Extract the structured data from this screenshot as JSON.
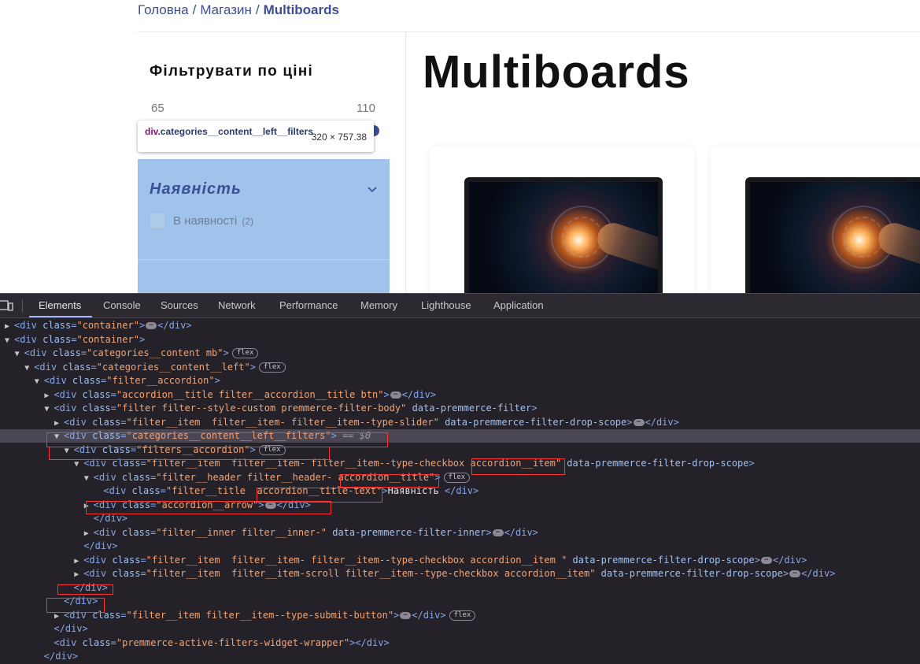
{
  "breadcrumb": {
    "home": "Головна",
    "shop": "Магазин",
    "current": "Multiboards",
    "separator": "/"
  },
  "filter": {
    "title": "Фільтрувати по ціні",
    "price_min": "65",
    "price_max": "110",
    "availability_title": "Наявність",
    "in_stock_label": "В наявності",
    "in_stock_count": "(2)"
  },
  "inspector_tooltip": {
    "tag": "div",
    "class": ".categories__content__left__filters",
    "size": "320 × 757.38"
  },
  "page_heading": "Multiboards",
  "devtools": {
    "tabs": [
      "Elements",
      "Console",
      "Sources",
      "Network",
      "Performance",
      "Memory",
      "Lighthouse",
      "Application"
    ],
    "active_tab": "Elements",
    "flex_badge": "flex",
    "ellipsis": "⋯",
    "selected_marker": "== $0",
    "dom_lines": [
      {
        "indent": 0,
        "arrow": "▶",
        "segs": [
          [
            "tg",
            "<div "
          ],
          [
            "an",
            "class"
          ],
          [
            "tg",
            "="
          ],
          [
            "av",
            "\"container\""
          ],
          [
            "tg",
            ">"
          ],
          [
            "ell",
            ""
          ],
          [
            "tg",
            "</div>"
          ]
        ]
      },
      {
        "indent": 0,
        "arrow": "▼",
        "segs": [
          [
            "tg",
            "<div "
          ],
          [
            "an",
            "class"
          ],
          [
            "tg",
            "="
          ],
          [
            "av",
            "\"container\""
          ],
          [
            "tg",
            ">"
          ]
        ]
      },
      {
        "indent": 1,
        "arrow": "▼",
        "segs": [
          [
            "tg",
            "<div "
          ],
          [
            "an",
            "class"
          ],
          [
            "tg",
            "="
          ],
          [
            "av",
            "\"categories__content mb\""
          ],
          [
            "tg",
            ">"
          ],
          [
            "badge",
            "flex"
          ]
        ]
      },
      {
        "indent": 2,
        "arrow": "▼",
        "segs": [
          [
            "tg",
            "<div "
          ],
          [
            "an",
            "class"
          ],
          [
            "tg",
            "="
          ],
          [
            "av",
            "\"categories__content__left\""
          ],
          [
            "tg",
            ">"
          ],
          [
            "badge",
            "flex"
          ]
        ]
      },
      {
        "indent": 3,
        "arrow": "▼",
        "segs": [
          [
            "tg",
            "<div "
          ],
          [
            "an",
            "class"
          ],
          [
            "tg",
            "="
          ],
          [
            "av",
            "\"filter__accordion\""
          ],
          [
            "tg",
            ">"
          ]
        ]
      },
      {
        "indent": 4,
        "arrow": "▶",
        "segs": [
          [
            "tg",
            "<div "
          ],
          [
            "an",
            "class"
          ],
          [
            "tg",
            "="
          ],
          [
            "av",
            "\"accordion__title filter__accordion__title btn\""
          ],
          [
            "tg",
            ">"
          ],
          [
            "ell",
            ""
          ],
          [
            "tg",
            "</div>"
          ]
        ]
      },
      {
        "indent": 4,
        "arrow": "▼",
        "segs": [
          [
            "tg",
            "<div "
          ],
          [
            "an",
            "class"
          ],
          [
            "tg",
            "="
          ],
          [
            "av",
            "\"filter filter--style-custom premmerce-filter-body\""
          ],
          [
            "an",
            " data-premmerce-filter"
          ],
          [
            "tg",
            ">"
          ]
        ]
      },
      {
        "indent": 5,
        "arrow": "▶",
        "segs": [
          [
            "tg",
            "<div "
          ],
          [
            "an",
            "class"
          ],
          [
            "tg",
            "="
          ],
          [
            "av",
            "\"filter__item  filter__item- filter__item--type-slider\""
          ],
          [
            "an",
            " data-premmerce-filter-drop-scope"
          ],
          [
            "tg",
            ">"
          ],
          [
            "ell",
            ""
          ],
          [
            "tg",
            "</div>"
          ]
        ]
      },
      {
        "indent": 5,
        "arrow": "▼",
        "sel": true,
        "segs": [
          [
            "tg",
            "<div "
          ],
          [
            "an",
            "class"
          ],
          [
            "tg",
            "="
          ],
          [
            "av",
            "\"categories__content__left__filters\""
          ],
          [
            "tg",
            ">"
          ],
          [
            "eq",
            " == $0"
          ]
        ]
      },
      {
        "indent": 6,
        "arrow": "▼",
        "segs": [
          [
            "tg",
            "<div "
          ],
          [
            "an",
            "class"
          ],
          [
            "tg",
            "="
          ],
          [
            "av",
            "\"filters__accordion\""
          ],
          [
            "tg",
            ">"
          ],
          [
            "badge",
            "flex"
          ]
        ]
      },
      {
        "indent": 7,
        "arrow": "▼",
        "segs": [
          [
            "tg",
            "<div "
          ],
          [
            "an",
            "class"
          ],
          [
            "tg",
            "="
          ],
          [
            "av",
            "\"filter__item  filter__item- filter__item--type-checkbox accordion__item\""
          ],
          [
            "an",
            " data-premmerce-filter-drop-scope"
          ],
          [
            "tg",
            ">"
          ]
        ]
      },
      {
        "indent": 8,
        "arrow": "▼",
        "segs": [
          [
            "tg",
            "<div "
          ],
          [
            "an",
            "class"
          ],
          [
            "tg",
            "="
          ],
          [
            "av",
            "\"filter__header filter__header- accordion__title\""
          ],
          [
            "tg",
            ">"
          ],
          [
            "badge",
            "flex"
          ]
        ]
      },
      {
        "indent": 9,
        "arrow": "",
        "segs": [
          [
            "tg",
            "<div "
          ],
          [
            "an",
            "class"
          ],
          [
            "tg",
            "="
          ],
          [
            "av",
            "\"filter__title  accordion__title-text\""
          ],
          [
            "tg",
            ">"
          ],
          [
            "txt",
            "Наявність "
          ],
          [
            "tg",
            "</div>"
          ]
        ]
      },
      {
        "indent": 8,
        "arrow": "▶",
        "segs": [
          [
            "tg",
            "<div "
          ],
          [
            "an",
            "class"
          ],
          [
            "tg",
            "="
          ],
          [
            "av",
            "\"accordion__arrow\""
          ],
          [
            "tg",
            ">"
          ],
          [
            "ell",
            ""
          ],
          [
            "tg",
            "</div>"
          ]
        ]
      },
      {
        "indent": 8,
        "arrow": "",
        "segs": [
          [
            "tg",
            "</div>"
          ]
        ]
      },
      {
        "indent": 8,
        "arrow": "▶",
        "segs": [
          [
            "tg",
            "<div "
          ],
          [
            "an",
            "class"
          ],
          [
            "tg",
            "="
          ],
          [
            "av",
            "\"filter__inner filter__inner-\""
          ],
          [
            "an",
            " data-premmerce-filter-inner"
          ],
          [
            "tg",
            ">"
          ],
          [
            "ell",
            ""
          ],
          [
            "tg",
            "</div>"
          ]
        ]
      },
      {
        "indent": 7,
        "arrow": "",
        "segs": [
          [
            "tg",
            "</div>"
          ]
        ]
      },
      {
        "indent": 7,
        "arrow": "▶",
        "segs": [
          [
            "tg",
            "<div "
          ],
          [
            "an",
            "class"
          ],
          [
            "tg",
            "="
          ],
          [
            "av",
            "\"filter__item  filter__item- filter__item--type-checkbox accordion__item \""
          ],
          [
            "an",
            " data-premmerce-filter-drop-scope"
          ],
          [
            "tg",
            ">"
          ],
          [
            "ell",
            ""
          ],
          [
            "tg",
            "</div>"
          ]
        ]
      },
      {
        "indent": 7,
        "arrow": "▶",
        "segs": [
          [
            "tg",
            "<div "
          ],
          [
            "an",
            "class"
          ],
          [
            "tg",
            "="
          ],
          [
            "av",
            "\"filter__item  filter__item-scroll filter__item--type-checkbox accordion__item\""
          ],
          [
            "an",
            " data-premmerce-filter-drop-scope"
          ],
          [
            "tg",
            ">"
          ],
          [
            "ell",
            ""
          ],
          [
            "tg",
            "</div>"
          ]
        ]
      },
      {
        "indent": 6,
        "arrow": "",
        "segs": [
          [
            "tg",
            "</div>"
          ]
        ]
      },
      {
        "indent": 5,
        "arrow": "",
        "segs": [
          [
            "tg",
            "</div>"
          ]
        ]
      },
      {
        "indent": 5,
        "arrow": "▶",
        "segs": [
          [
            "tg",
            "<div "
          ],
          [
            "an",
            "class"
          ],
          [
            "tg",
            "="
          ],
          [
            "av",
            "\"filter__item filter__item--type-submit-button\""
          ],
          [
            "tg",
            ">"
          ],
          [
            "ell",
            ""
          ],
          [
            "tg",
            "</div>"
          ],
          [
            "badge",
            "flex"
          ]
        ]
      },
      {
        "indent": 4,
        "arrow": "",
        "segs": [
          [
            "tg",
            "</div>"
          ]
        ]
      },
      {
        "indent": 4,
        "arrow": "",
        "segs": [
          [
            "tg",
            "<div "
          ],
          [
            "an",
            "class"
          ],
          [
            "tg",
            "="
          ],
          [
            "av",
            "\"premmerce-active-filters-widget-wrapper\""
          ],
          [
            "tg",
            "></div>"
          ]
        ]
      },
      {
        "indent": 3,
        "arrow": "",
        "segs": [
          [
            "tg",
            "</div>"
          ]
        ]
      }
    ]
  }
}
